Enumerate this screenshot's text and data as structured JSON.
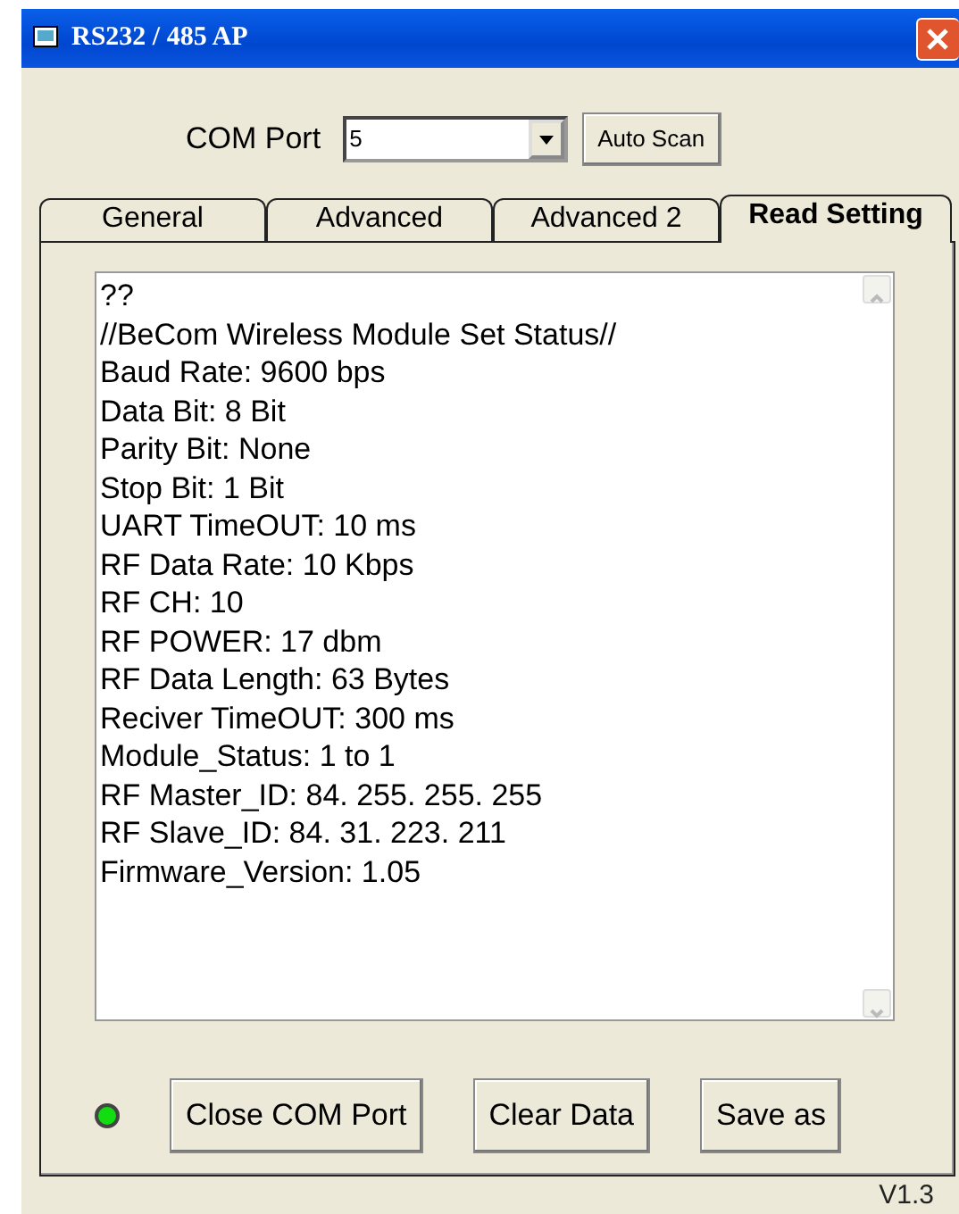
{
  "window": {
    "title": "RS232 / 485 AP"
  },
  "com_port": {
    "label": "COM Port",
    "value": "5",
    "scan_button": "Auto Scan"
  },
  "tabs": [
    {
      "label": "General",
      "selected": false
    },
    {
      "label": "Advanced",
      "selected": false
    },
    {
      "label": "Advanced 2",
      "selected": false
    },
    {
      "label": "Read Setting",
      "selected": true
    }
  ],
  "output_lines": [
    "??",
    "//BeCom Wireless Module Set Status//",
    "Baud Rate: 9600 bps",
    "Data Bit: 8 Bit",
    "Parity Bit: None",
    "Stop Bit: 1 Bit",
    "UART TimeOUT: 10 ms",
    "RF Data Rate: 10 Kbps",
    "RF CH: 10",
    "RF POWER: 17 dbm",
    "RF Data Length: 63 Bytes",
    "Reciver TimeOUT: 300 ms",
    "Module_Status: 1 to 1",
    "RF Master_ID: 84. 255. 255. 255",
    "RF Slave_ID: 84. 31. 223. 211",
    "Firmware_Version: 1.05"
  ],
  "port_open": true,
  "buttons": [
    "Close COM Port",
    "Clear Data",
    "Save as"
  ],
  "version": "V1.3"
}
